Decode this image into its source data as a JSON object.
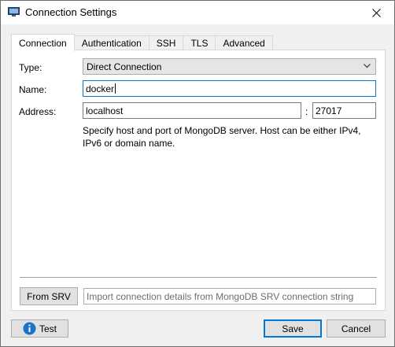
{
  "window": {
    "title": "Connection Settings",
    "icon": "monitor-icon",
    "close_icon": "close-icon"
  },
  "tabs": [
    {
      "label": "Connection",
      "active": true
    },
    {
      "label": "Authentication",
      "active": false
    },
    {
      "label": "SSH",
      "active": false
    },
    {
      "label": "TLS",
      "active": false
    },
    {
      "label": "Advanced",
      "active": false
    }
  ],
  "connection": {
    "type_label": "Type:",
    "type_value": "Direct Connection",
    "name_label": "Name:",
    "name_value": "docker",
    "address_label": "Address:",
    "address_value": "localhost",
    "port_separator": ":",
    "port_value": "27017",
    "hint": "Specify host and port of MongoDB server. Host can be either IPv4, IPv6 or domain name."
  },
  "srv": {
    "button_label": "From SRV",
    "placeholder": "Import connection details from MongoDB SRV connection string"
  },
  "footer": {
    "test_label": "Test",
    "save_label": "Save",
    "cancel_label": "Cancel"
  },
  "colors": {
    "accent": "#0078d7",
    "info_icon": "#1a73c8"
  }
}
